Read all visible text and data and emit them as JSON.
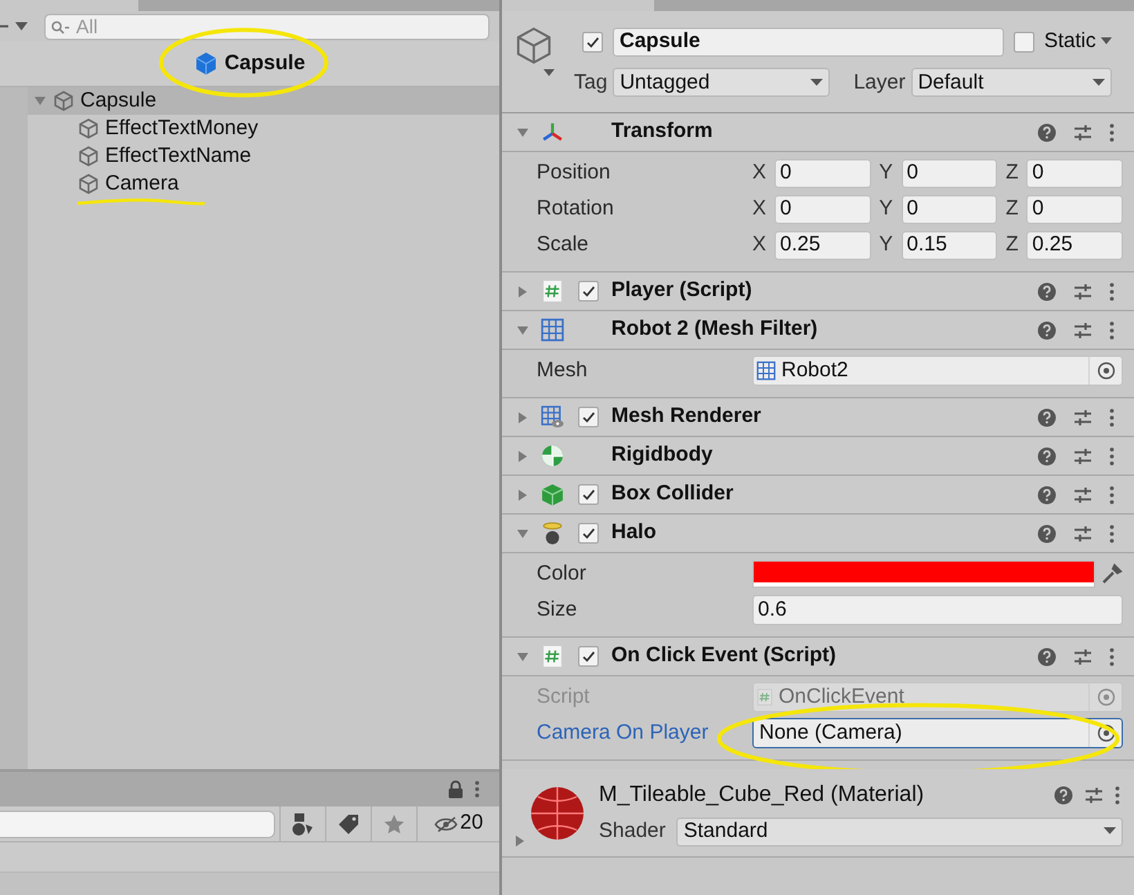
{
  "hierarchy": {
    "search": {
      "placeholder": "All"
    },
    "scene_header": {
      "label": "Capsule",
      "circled": true
    },
    "tree": [
      {
        "label": "Capsule",
        "selected": true,
        "expanded": true,
        "underlined": false,
        "children": [
          {
            "label": "EffectTextMoney",
            "selected": false,
            "underlined": false
          },
          {
            "label": "EffectTextName",
            "selected": false,
            "underlined": false
          },
          {
            "label": "Camera",
            "selected": false,
            "underlined": true
          }
        ]
      }
    ]
  },
  "inspector": {
    "header": {
      "active": true,
      "name": "Capsule",
      "static": false,
      "static_label": "Static",
      "tag_label": "Tag",
      "tag": "Untagged",
      "layer_label": "Layer",
      "layer": "Default"
    },
    "components": [
      {
        "kind": "transform",
        "title": "Transform",
        "expanded": true,
        "fields": [
          {
            "kind": "vector3",
            "label": "Position",
            "components": [
              {
                "axis": "X",
                "value": "0"
              },
              {
                "axis": "Y",
                "value": "0"
              },
              {
                "axis": "Z",
                "value": "0"
              }
            ]
          },
          {
            "kind": "vector3",
            "label": "Rotation",
            "components": [
              {
                "axis": "X",
                "value": "0"
              },
              {
                "axis": "Y",
                "value": "0"
              },
              {
                "axis": "Z",
                "value": "0"
              }
            ]
          },
          {
            "kind": "vector3",
            "label": "Scale",
            "components": [
              {
                "axis": "X",
                "value": "0.25"
              },
              {
                "axis": "Y",
                "value": "0.15"
              },
              {
                "axis": "Z",
                "value": "0.25"
              }
            ]
          }
        ]
      },
      {
        "kind": "script",
        "title": "Player (Script)",
        "expanded": false,
        "enabled": true
      },
      {
        "kind": "mesh",
        "title": "Robot 2 (Mesh Filter)",
        "expanded": true,
        "fields": [
          {
            "kind": "object",
            "label": "Mesh",
            "value": "Robot2",
            "mesh_icon": true,
            "disabled": false,
            "focused": false,
            "circled": false
          }
        ]
      },
      {
        "kind": "renderer",
        "title": "Mesh Renderer",
        "expanded": false,
        "enabled": true
      },
      {
        "kind": "rigidbody",
        "title": "Rigidbody",
        "expanded": false
      },
      {
        "kind": "collider",
        "title": "Box Collider",
        "expanded": false,
        "enabled": true
      },
      {
        "kind": "halo",
        "title": "Halo",
        "expanded": true,
        "enabled": true,
        "fields": [
          {
            "kind": "color",
            "label": "Color",
            "color": "#ff0000"
          },
          {
            "kind": "number",
            "label": "Size",
            "value": "0.6"
          }
        ]
      },
      {
        "kind": "script",
        "title": "On Click Event (Script)",
        "expanded": true,
        "enabled": true,
        "fields": [
          {
            "kind": "object",
            "label": "Script",
            "value": "OnClickEvent",
            "mesh_icon": false,
            "disabled": true,
            "focused": false,
            "circled": false
          },
          {
            "kind": "object",
            "label": "Camera On Player",
            "value": "None (Camera)",
            "mesh_icon": false,
            "disabled": false,
            "focused": true,
            "circled": true
          }
        ]
      }
    ],
    "material": {
      "name": "M_Tileable_Cube_Red (Material)",
      "shader_label": "Shader",
      "shader": "Standard",
      "expanded": false
    }
  },
  "project": {
    "hidden_count": "20"
  }
}
